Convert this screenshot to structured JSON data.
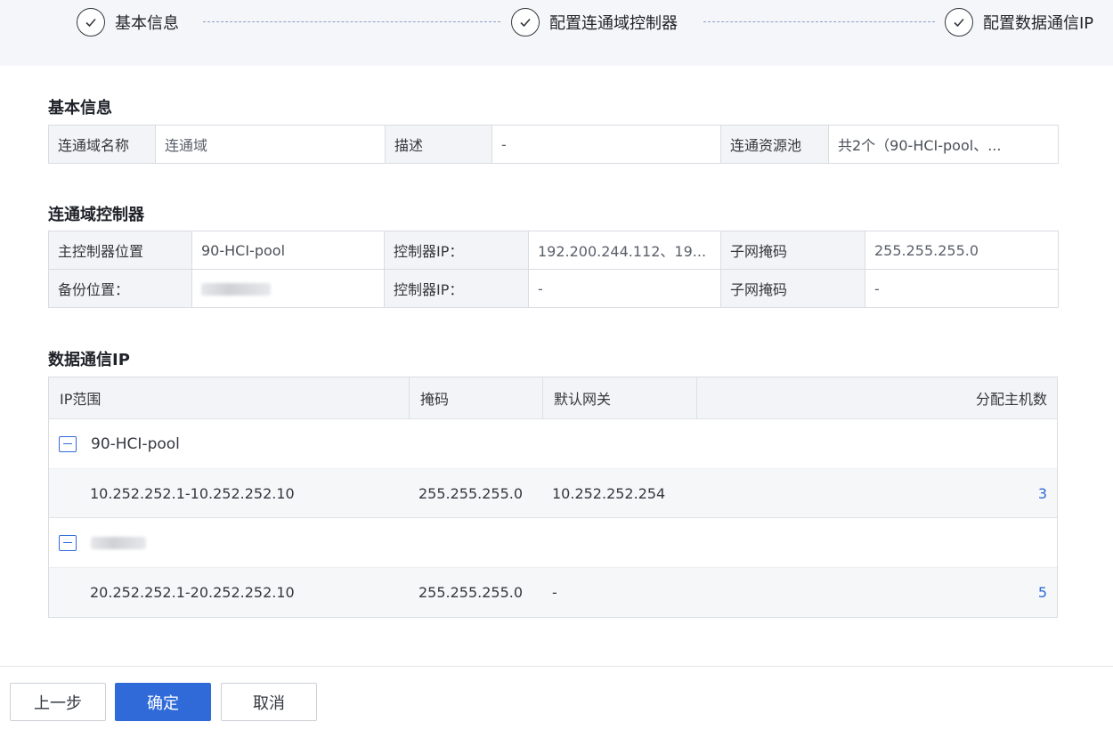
{
  "stepper": {
    "steps": [
      {
        "label": "基本信息"
      },
      {
        "label": "配置连通域控制器"
      },
      {
        "label": "配置数据通信IP"
      }
    ]
  },
  "basic_info": {
    "title": "基本信息",
    "fields": [
      {
        "key": "连通域名称",
        "value": "连通域"
      },
      {
        "key": "描述",
        "value": "-"
      },
      {
        "key": "连通资源池",
        "value": "共2个（90-HCI-pool、..."
      }
    ]
  },
  "controller": {
    "title": "连通域控制器",
    "rows": [
      [
        {
          "key": "主控制器位置",
          "value": "90-HCI-pool"
        },
        {
          "key": "控制器IP：",
          "value": "192.200.244.112、19..."
        },
        {
          "key": "子网掩码",
          "value": "255.255.255.0"
        }
      ],
      [
        {
          "key": "备份位置：",
          "value": ""
        },
        {
          "key": "控制器IP：",
          "value": "-"
        },
        {
          "key": "子网掩码",
          "value": "-"
        }
      ]
    ]
  },
  "data_ip": {
    "title": "数据通信IP",
    "columns": [
      "IP范围",
      "掩码",
      "默认网关",
      "分配主机数"
    ],
    "groups": [
      {
        "name": "90-HCI-pool",
        "row": {
          "ip_range": "10.252.252.1-10.252.252.10",
          "mask": "255.255.255.0",
          "gateway": "10.252.252.254",
          "hosts": "3"
        }
      },
      {
        "name": "",
        "row": {
          "ip_range": "20.252.252.1-20.252.252.10",
          "mask": "255.255.255.0",
          "gateway": "-",
          "hosts": "5"
        }
      }
    ]
  },
  "footer": {
    "prev_label": "上一步",
    "confirm_label": "确定",
    "cancel_label": "取消"
  },
  "colors": {
    "primary": "#2f6ad8",
    "stepper_bg": "#f5f6f9",
    "table_key_bg": "#f3f4f7"
  }
}
